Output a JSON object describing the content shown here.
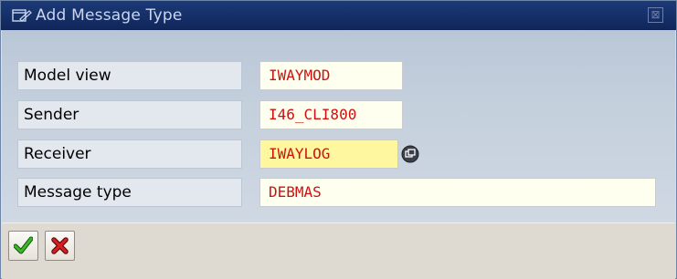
{
  "dialog": {
    "title": "Add Message Type",
    "close_glyph": "⊠"
  },
  "fields": [
    {
      "label": "Model view",
      "value": "IWAYMOD"
    },
    {
      "label": "Sender",
      "value": "I46_CLI800"
    },
    {
      "label": "Receiver",
      "value": "IWAYLOG"
    },
    {
      "label": "Message type",
      "value": "DEBMAS"
    }
  ],
  "toolbar": {
    "confirm_icon": "green-check-icon",
    "cancel_icon": "red-x-icon"
  },
  "colors": {
    "title_bar": "#1c3a78",
    "field_value_text": "#d01010",
    "focused_field_bg": "#fff7a0"
  }
}
